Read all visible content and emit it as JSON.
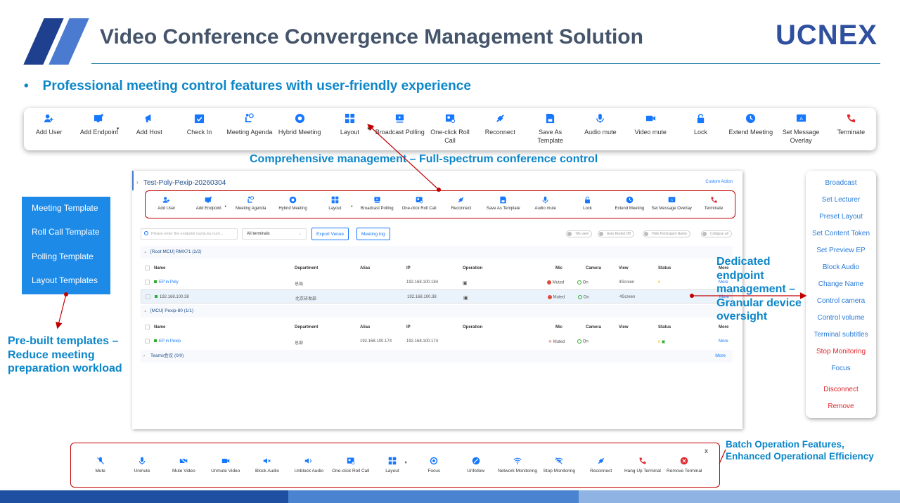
{
  "header": {
    "title": "Video Conference Convergence Management Solution",
    "brand": "UCNEX",
    "subtitle": "Professional meeting control features with user-friendly experience"
  },
  "top_toolbar": [
    {
      "label": "Add User",
      "icon": "add-user-icon"
    },
    {
      "label": "Add Endpoint",
      "icon": "add-endpoint-icon",
      "dropdown": true
    },
    {
      "label": "Add Host",
      "icon": "add-host-icon"
    },
    {
      "label": "Check In",
      "icon": "check-in-icon"
    },
    {
      "label": "Meeting Agenda",
      "icon": "meeting-agenda-icon"
    },
    {
      "label": "Hybrid Meeting",
      "icon": "hybrid-meeting-icon"
    },
    {
      "label": "Layout",
      "icon": "layout-icon",
      "dropdown": true
    },
    {
      "label": "Broadcast Polling",
      "icon": "broadcast-polling-icon"
    },
    {
      "label": "One-click Roll Call",
      "icon": "roll-call-icon"
    },
    {
      "label": "Reconnect",
      "icon": "reconnect-icon"
    },
    {
      "label": "Save As Template",
      "icon": "save-template-icon"
    },
    {
      "label": "Audio mute",
      "icon": "microphone-icon"
    },
    {
      "label": "Video mute",
      "icon": "video-icon"
    },
    {
      "label": "Lock",
      "icon": "lock-icon"
    },
    {
      "label": "Extend Meeting",
      "icon": "clock-icon"
    },
    {
      "label": "Set Message Overlay",
      "icon": "message-overlay-icon"
    },
    {
      "label": "Terminate",
      "icon": "terminate-icon"
    }
  ],
  "callouts": {
    "toolbar": "Comprehensive management – Full-spectrum conference control",
    "templates": "Pre-built templates – Reduce meeting preparation workload",
    "endpoint": "Dedicated endpoint management – Granular device oversight",
    "batch_line1": "Batch Operation Features,",
    "batch_line2": "Enhanced Operational Efficiency"
  },
  "templates": [
    "Meeting Template",
    "Roll Call Template",
    "Polling Template",
    "Layout Templates"
  ],
  "panel": {
    "meeting_name": "Test-Poly-Pexip-20260304",
    "custom_action": "Custom Action",
    "toolbar": [
      {
        "label": "Add User",
        "icon": "add-user-icon"
      },
      {
        "label": "Add Endpoint",
        "icon": "add-endpoint-icon",
        "dropdown": true
      },
      {
        "label": "Meeting Agenda",
        "icon": "meeting-agenda-icon"
      },
      {
        "label": "Hybrid Meeting",
        "icon": "hybrid-meeting-icon"
      },
      {
        "label": "Layout",
        "icon": "layout-icon",
        "dropdown": true
      },
      {
        "label": "Broadcast Polling",
        "icon": "broadcast-polling-icon"
      },
      {
        "label": "One-click Roll Call",
        "icon": "roll-call-icon"
      },
      {
        "label": "Reconnect",
        "icon": "reconnect-icon"
      },
      {
        "label": "Save As Template",
        "icon": "save-template-icon"
      },
      {
        "label": "Audio mute",
        "icon": "microphone-icon"
      },
      {
        "label": "Lock",
        "icon": "lock-icon"
      },
      {
        "label": "Extend Meeting",
        "icon": "clock-icon"
      },
      {
        "label": "Set Message Overlay",
        "icon": "message-overlay-icon"
      },
      {
        "label": "Terminate",
        "icon": "terminate-icon"
      }
    ],
    "search_placeholder": "Please enter the endpoint name,bu num...",
    "filter_select": "All terminals",
    "export_venue": "Export Venue",
    "meeting_log": "Meeting log",
    "toggles": [
      "Tile view",
      "Auto Redial Off",
      "Hide Participant Name",
      "Collapse all"
    ],
    "columns": [
      "Name",
      "Department",
      "Alias",
      "IP",
      "Operation",
      "Mic",
      "Camera",
      "View",
      "Status",
      "More"
    ],
    "groups": [
      {
        "title": "[Root MCU] RMX71  (2/2)",
        "rows": [
          {
            "name": "EP in Poly",
            "dept": "总局",
            "alias": "",
            "ip": "192.168.100.184",
            "mic": "Muted",
            "camera": "On",
            "view": "4Screen",
            "more": "More"
          },
          {
            "name": "192.168.100.38",
            "dept": "北京研发部",
            "alias": "",
            "ip": "192.168.100.38",
            "mic": "Muted",
            "camera": "On",
            "view": "4Screen",
            "more": "More"
          }
        ]
      },
      {
        "title": "[MCU] Pexip-80  (1/1)",
        "rows": [
          {
            "name": "EP in Pexip",
            "dept": "总部",
            "alias": "192.168.100.174",
            "ip": "192.168.100.174",
            "mic": "Muted",
            "camera": "On",
            "view": "",
            "more": "More"
          }
        ]
      },
      {
        "title": "Teams会议  (0/0)",
        "rows": [],
        "more": "More"
      }
    ]
  },
  "right_menu": [
    {
      "label": "Broadcast"
    },
    {
      "label": "Set Lecturer"
    },
    {
      "label": "Preset Layout"
    },
    {
      "label": "Set Content Token"
    },
    {
      "label": "Set Preview EP"
    },
    {
      "label": "Block Audio"
    },
    {
      "label": "Change Name"
    },
    {
      "label": "Control camera"
    },
    {
      "label": "Control volume"
    },
    {
      "label": "Terminal subtitles"
    },
    {
      "label": "Stop Monitoring",
      "danger": true
    },
    {
      "label": "Focus"
    },
    {
      "label": "Disconnect",
      "danger": true
    },
    {
      "label": "Remove",
      "danger": true
    }
  ],
  "batch_toolbar": [
    {
      "label": "Mute",
      "icon": "mic-off-icon"
    },
    {
      "label": "Unmute",
      "icon": "microphone-icon"
    },
    {
      "label": "Mute Video",
      "icon": "video-off-icon"
    },
    {
      "label": "Unmute Video",
      "icon": "video-icon"
    },
    {
      "label": "Block Audio",
      "icon": "speaker-off-icon"
    },
    {
      "label": "Unblock Audio",
      "icon": "speaker-icon"
    },
    {
      "label": "One-click Roll Call",
      "icon": "roll-call-icon"
    },
    {
      "label": "Layout",
      "icon": "layout-icon",
      "dropdown": true
    },
    {
      "label": "Focus",
      "icon": "focus-icon"
    },
    {
      "label": "Unfollow",
      "icon": "unfollow-icon"
    },
    {
      "label": "Network Monitoring",
      "icon": "wifi-icon"
    },
    {
      "label": "Stop Monitoring",
      "icon": "wifi-off-icon"
    },
    {
      "label": "Reconnect",
      "icon": "reconnect-icon"
    },
    {
      "label": "Hang Up Terminal",
      "icon": "hang-up-icon"
    },
    {
      "label": "Remove Terminal",
      "icon": "remove-icon"
    }
  ],
  "batch_close": "x",
  "colors": {
    "accent": "#1677ff",
    "heading": "#44546a",
    "callout": "#0b86c9",
    "brand": "#2f4f9f",
    "danger": "#e0282e",
    "highlight_box": "#c00000"
  }
}
